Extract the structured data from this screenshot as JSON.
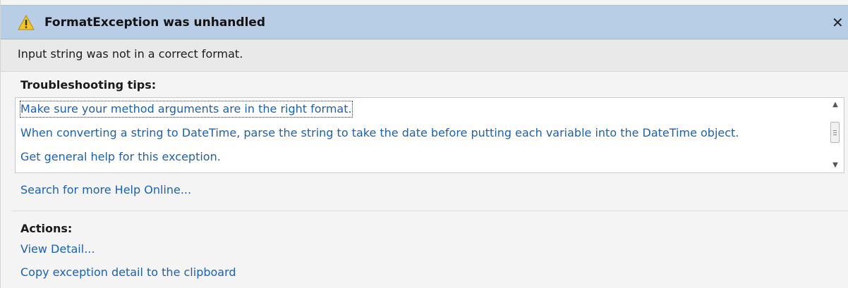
{
  "dialog": {
    "title": "FormatException was unhandled",
    "message": "Input string was not in a correct format.",
    "close_glyph": "✕",
    "accent_color": "#b8cde6",
    "link_color": "#1b61b3"
  },
  "troubleshooting": {
    "heading": "Troubleshooting tips:",
    "tips": [
      "Make sure your method arguments are in the right format.",
      "When converting a string to DateTime, parse the string to take the date before putting each variable into the DateTime object.",
      "Get general help for this exception."
    ],
    "search_link": "Search for more Help Online..."
  },
  "actions": {
    "heading": "Actions:",
    "items": [
      "View Detail...",
      "Copy exception detail to the clipboard"
    ]
  },
  "icons": {
    "title_icon": "warning-icon",
    "close": "close-icon",
    "scroll_up": "scroll-up-arrow-icon",
    "scroll_down": "scroll-down-arrow-icon"
  }
}
